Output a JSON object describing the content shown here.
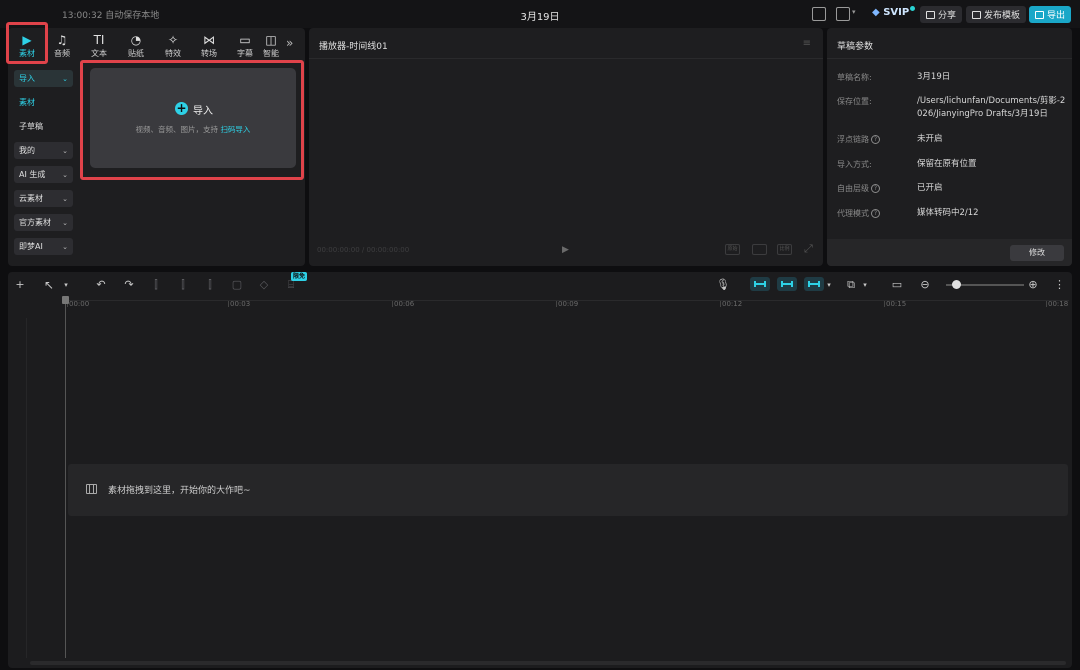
{
  "titlebar": {
    "save_status": "13:00:32 自动保存本地",
    "project_title": "3月19日",
    "svip_label": "SVIP",
    "share_label": "分享",
    "publish_label": "发布模板",
    "export_label": "导出"
  },
  "media_tabs": [
    {
      "label": "素材",
      "icon": "media-icon",
      "glyph": "▶"
    },
    {
      "label": "音频",
      "icon": "audio-icon",
      "glyph": "♫"
    },
    {
      "label": "文本",
      "icon": "text-icon",
      "glyph": "TI"
    },
    {
      "label": "贴纸",
      "icon": "sticker-icon",
      "glyph": "◔"
    },
    {
      "label": "特效",
      "icon": "effects-icon",
      "glyph": "✧"
    },
    {
      "label": "转场",
      "icon": "transition-icon",
      "glyph": "⋈"
    },
    {
      "label": "字幕",
      "icon": "caption-icon",
      "glyph": "▭"
    },
    {
      "label": "智能",
      "icon": "smart-icon",
      "glyph": "◫"
    }
  ],
  "more_tabs_glyph": "»",
  "sidebar": {
    "import": "导入",
    "material": "素材",
    "subdraft": "子草稿",
    "mine": "我的",
    "ai_gen": "AI 生成",
    "cloud": "云素材",
    "official": "官方素材",
    "jimeng": "即梦AI"
  },
  "import_box": {
    "title": "导入",
    "hint": "视频、音频、图片，支持 ",
    "hint_link": "扫码导入"
  },
  "player": {
    "title": "播放器-时间线01",
    "timecode": "00:00:00:00 / 00:00:00:00",
    "controls": [
      "原始",
      "比例"
    ]
  },
  "properties": {
    "title": "草稿参数",
    "rows": [
      {
        "label": "草稿名称:",
        "value": "3月19日"
      },
      {
        "label": "保存位置:",
        "value": "/Users/lichunfan/Documents/剪影-2026/JianyingPro Drafts/3月19日"
      },
      {
        "label": "浮点链路",
        "value": "未开启"
      },
      {
        "label": "导入方式:",
        "value": "保留在原有位置"
      },
      {
        "label": "自由层级",
        "value": "已开启"
      },
      {
        "label": "代理模式",
        "value": "媒体转码中2/12"
      }
    ],
    "edit_button": "修改"
  },
  "timeline": {
    "badge": "限免",
    "ruler": [
      "00:00",
      "00:03",
      "00:06",
      "00:09",
      "00:12",
      "00:15",
      "00:18"
    ],
    "drop_hint": "素材拖拽到这里，开始你的大作吧~"
  },
  "colors": {
    "accent": "#2ed1e6",
    "highlight": "#e0434a",
    "panel": "#1e1e20",
    "background": "#0e0e10"
  }
}
